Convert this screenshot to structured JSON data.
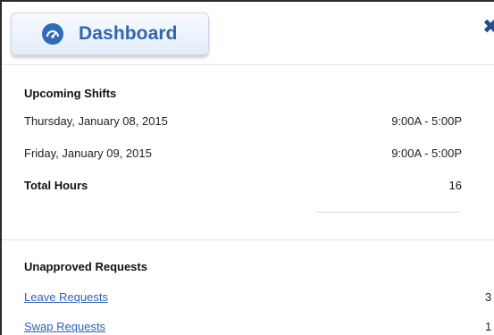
{
  "header": {
    "tab_label": "Dashboard",
    "close_glyph": "✖",
    "icon": "gauge-icon",
    "accent_color": "#2f67af"
  },
  "upcoming_shifts": {
    "title": "Upcoming Shifts",
    "rows": [
      {
        "date": "Thursday, January 08, 2015",
        "time": "9:00A - 5:00P"
      },
      {
        "date": "Friday, January 09, 2015",
        "time": "9:00A - 5:00P"
      }
    ],
    "total_label": "Total Hours",
    "total_value": "16"
  },
  "unapproved_requests": {
    "title": "Unapproved Requests",
    "items": [
      {
        "label": "Leave Requests",
        "count": "3"
      },
      {
        "label": "Swap Requests",
        "count": "1"
      }
    ]
  }
}
